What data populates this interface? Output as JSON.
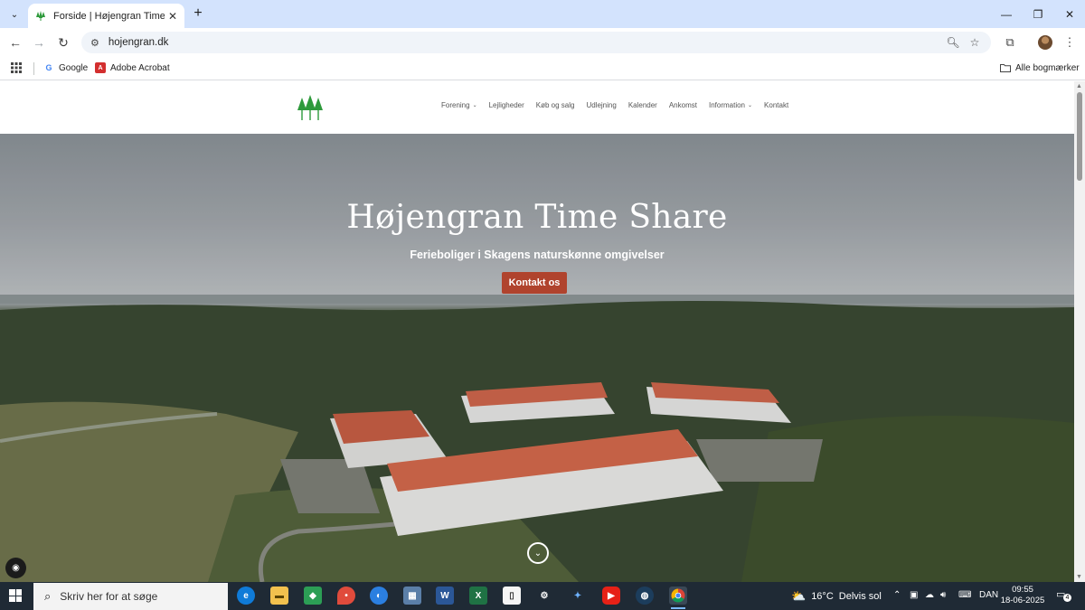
{
  "browser": {
    "tab_title": "Forside | Højengran Time Share",
    "url": "hojengran.dk",
    "new_tab_label": "+",
    "bookmarks": [
      {
        "label": "Google"
      },
      {
        "label": "Adobe Acrobat"
      }
    ],
    "all_bookmarks_label": "Alle bogmærker"
  },
  "site": {
    "nav": [
      {
        "label": "Forening",
        "has_dropdown": true
      },
      {
        "label": "Lejligheder",
        "has_dropdown": false
      },
      {
        "label": "Køb og salg",
        "has_dropdown": false
      },
      {
        "label": "Udlejning",
        "has_dropdown": false
      },
      {
        "label": "Kalender",
        "has_dropdown": false
      },
      {
        "label": "Ankomst",
        "has_dropdown": false
      },
      {
        "label": "Information",
        "has_dropdown": true
      },
      {
        "label": "Kontakt",
        "has_dropdown": false
      }
    ],
    "hero": {
      "title": "Højengran Time Share",
      "subtitle": "Ferieboliger i Skagens naturskønne omgivelser",
      "button_label": "Kontakt os"
    },
    "colors": {
      "accent_button": "#b0432d",
      "logo_green": "#2e9a3b"
    }
  },
  "taskbar": {
    "search_placeholder": "Skriv her for at søge",
    "weather_temp": "16°C",
    "weather_desc": "Delvis sol",
    "language": "DAN",
    "time": "09:55",
    "date": "18-06-2025",
    "notification_count": "4"
  }
}
